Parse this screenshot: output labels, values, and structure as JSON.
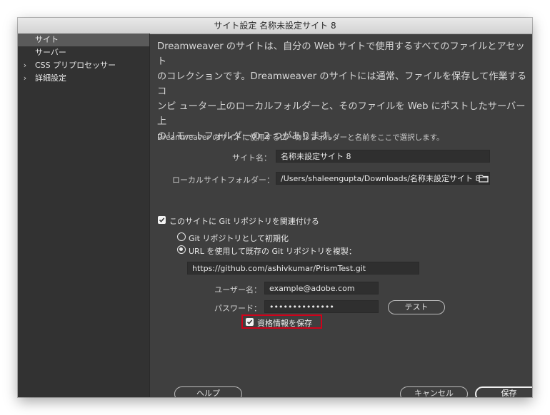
{
  "window": {
    "title": "サイト設定 名称未設定サイト 8"
  },
  "sidebar": {
    "items": [
      {
        "label": "サイト",
        "selected": true,
        "expandable": false
      },
      {
        "label": "サーバー",
        "selected": false,
        "expandable": false
      },
      {
        "label": "CSS プリプロセッサー",
        "selected": false,
        "expandable": true
      },
      {
        "label": "詳細設定",
        "selected": false,
        "expandable": true
      }
    ]
  },
  "main": {
    "description_lines": [
      "Dreamweaver のサイトは、自分の Web サイトで使用するすべてのファイルとアセット",
      "のコレクションです。Dreamweaver のサイトには通常、ファイルを保存して作業するコ",
      "ンピ ューター上のローカルフォルダーと、そのファイルを Web にポストしたサーバー上",
      "のリモートフォルダーの 2 つがあります。"
    ],
    "hint": "Dreamweaver のサイトに使用するローカルフォルダーと名前をここで選択します。",
    "site_name": {
      "label": "サイト名：",
      "value": "名称未設定サイト 8"
    },
    "local_folder": {
      "label": "ローカルサイトフォルダー：",
      "value": "/Users/shaleengupta/Downloads/名称未設定サイト 8",
      "icon": "folder-icon"
    },
    "git": {
      "associate_label": "このサイトに Git リポジトリを関連付ける",
      "associate_checked": true,
      "init_label": "Git リポジトリとして初期化",
      "init_selected": false,
      "clone_label": "URL を使用して既存の Git リポジトリを複製：",
      "clone_selected": true,
      "url": "https://github.com/ashivkumar/PrismTest.git",
      "username_label": "ユーザー名：",
      "username": "example@adobe.com",
      "password_label": "パスワード：",
      "password_mask": "••••••••••••••",
      "test_button": "テスト",
      "save_credentials_label": "資格情報を保存",
      "save_credentials_checked": true
    }
  },
  "footer": {
    "help": "ヘルプ",
    "cancel": "キャンセル",
    "save": "保存"
  },
  "colors": {
    "highlight": "#d0021b",
    "panel": "#3f3f3f",
    "sidebar": "#323232"
  }
}
